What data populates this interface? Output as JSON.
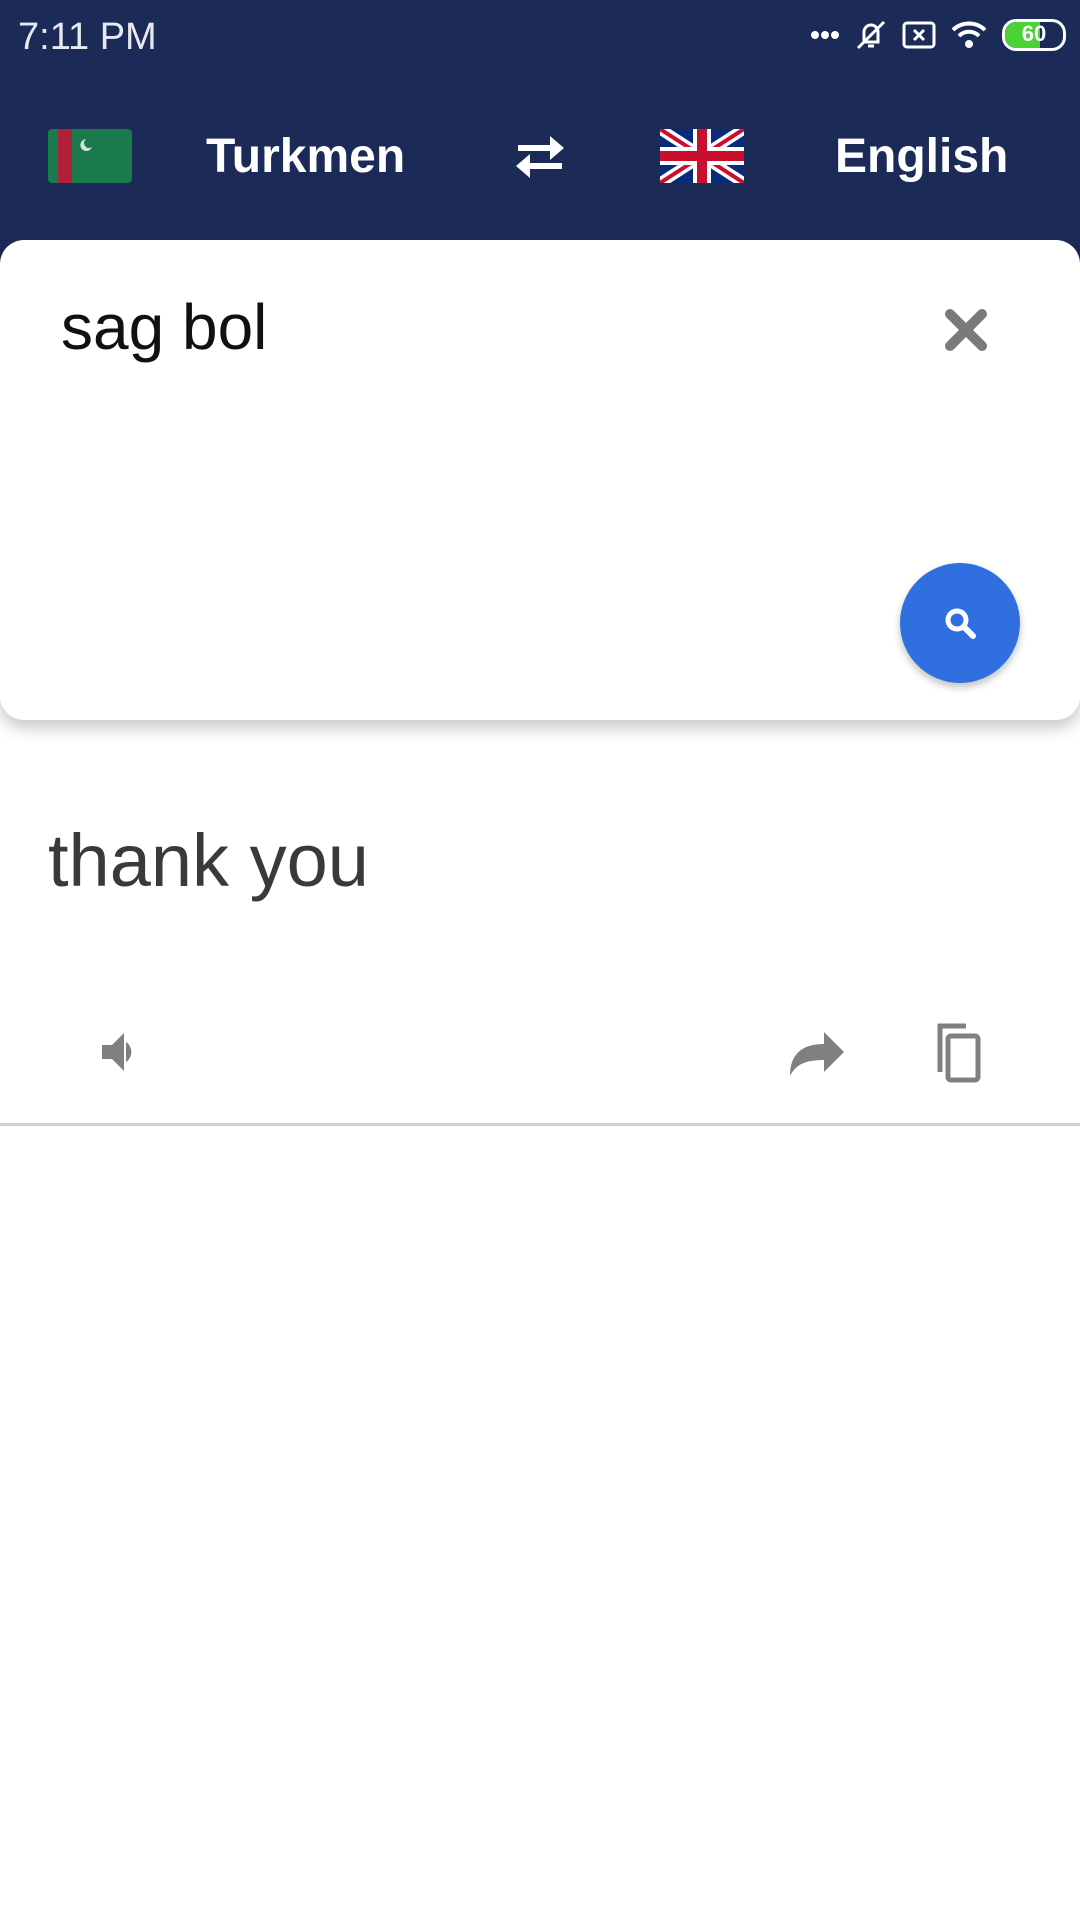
{
  "status_bar": {
    "time": "7:11 PM",
    "battery": "60",
    "icons": [
      "more-dots-icon",
      "bell-off-icon",
      "sim-x-icon",
      "wifi-icon",
      "battery-icon"
    ]
  },
  "header": {
    "source_language": "Turkmen",
    "target_language": "English",
    "source_flag": "turkmenistan-flag",
    "target_flag": "uk-flag",
    "swap_icon": "swap-arrows-icon"
  },
  "input": {
    "value": "sag bol"
  },
  "result": {
    "text": "thank you"
  },
  "colors": {
    "header_bg": "#1c2a57",
    "accent": "#2f6fdf",
    "icon_gray": "#808080"
  }
}
